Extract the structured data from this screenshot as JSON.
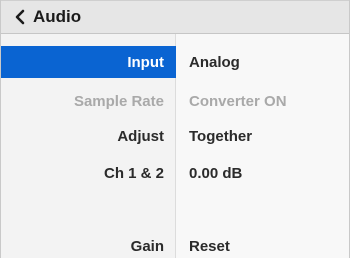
{
  "header": {
    "title": "Audio",
    "back_icon": "chevron-left-icon"
  },
  "settings": [
    {
      "label": "Input",
      "value": "Analog",
      "selected": true,
      "enabled": true
    },
    {
      "label": "Sample Rate",
      "value": "Converter ON",
      "selected": false,
      "enabled": false
    },
    {
      "label": "Adjust",
      "value": "Together",
      "selected": false,
      "enabled": true
    },
    {
      "label": "Ch 1 & 2",
      "value": "0.00 dB",
      "selected": false,
      "enabled": true
    },
    {
      "label": "Gain",
      "value": "Reset",
      "selected": false,
      "enabled": true
    }
  ],
  "colors": {
    "selection": "#0a64d2",
    "disabled_text": "#a9a9a9"
  }
}
